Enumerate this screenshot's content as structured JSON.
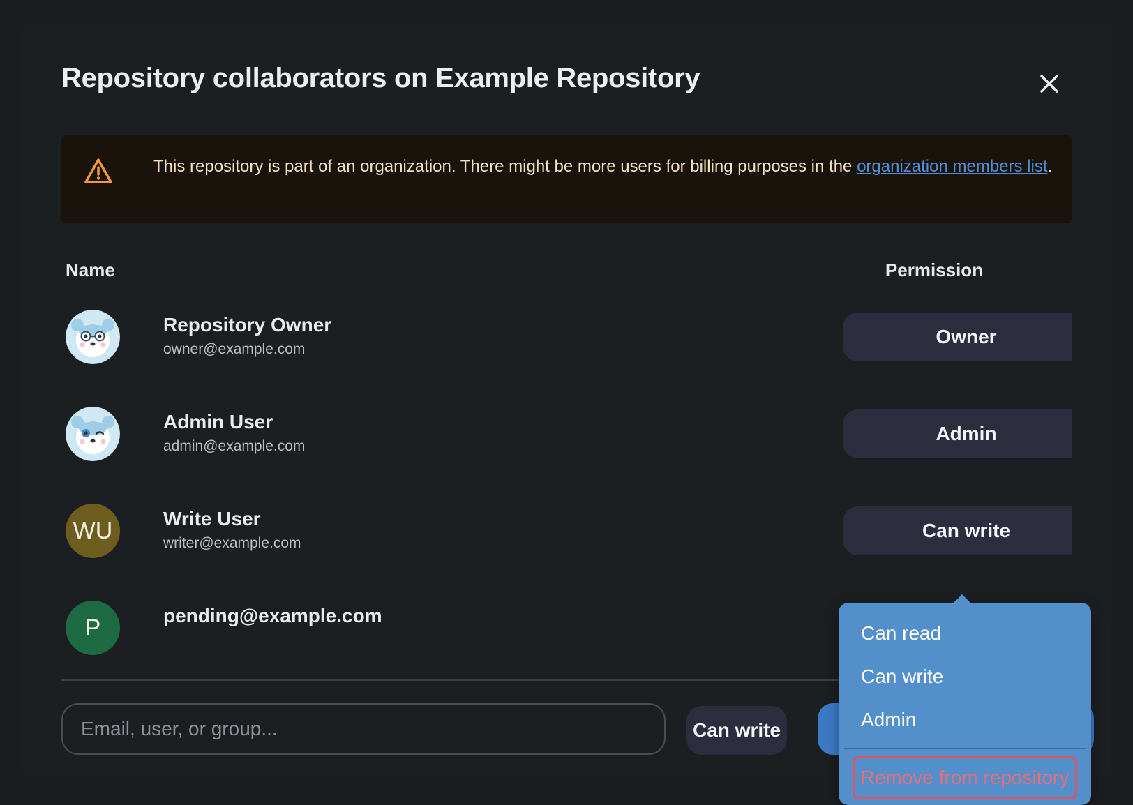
{
  "dialog": {
    "title": "Repository collaborators on Example Repository",
    "close_icon": "close-icon"
  },
  "alert": {
    "icon": "warning-icon",
    "text": "This repository is part of an organization. There might be more users for billing purposes in the ",
    "link_text": "organization members list",
    "suffix": ".",
    "colors": {
      "background": "#19130b",
      "text": "#f4e1bf",
      "link": "#4f8fd6",
      "icon": "#f29a38"
    }
  },
  "table": {
    "headers": {
      "name": "Name",
      "permission": "Permission"
    },
    "rows": [
      {
        "name": "Repository Owner",
        "email": "owner@example.com",
        "permission": "Owner",
        "avatar": "bear-glasses-avatar"
      },
      {
        "name": "Admin User",
        "email": "admin@example.com",
        "permission": "Admin",
        "avatar": "bear-wink-avatar"
      },
      {
        "name": "Write User",
        "email": "writer@example.com",
        "permission": "Can write",
        "avatar_initials": "WU",
        "avatar_color": "#6d5e1f"
      },
      {
        "name": "pending@example.com",
        "avatar_initials": "P",
        "avatar_color": "#1e6b43"
      }
    ]
  },
  "invite": {
    "placeholder": "Email, user, or group...",
    "permission": "Can write"
  },
  "dropdown": {
    "items": [
      "Can read",
      "Can write",
      "Admin"
    ],
    "remove_label": "Remove from repository",
    "colors": {
      "background": "#538fcb",
      "remove": "#e4515d"
    }
  }
}
